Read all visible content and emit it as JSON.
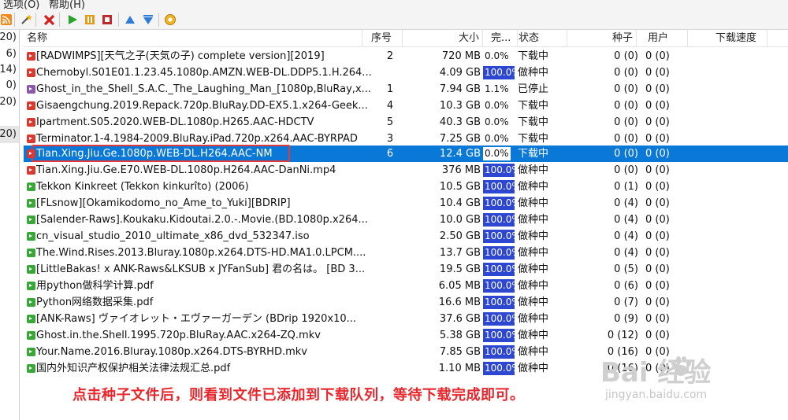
{
  "menubar": {
    "items": [
      "选项(O)",
      "帮助(H)"
    ]
  },
  "toolbar": {
    "icons": [
      "rss-icon",
      "wand-icon",
      "delete-icon",
      "play-icon",
      "pause-icon",
      "stop-icon",
      "move-up-icon",
      "move-down-icon",
      "settings-icon"
    ]
  },
  "left_panel": {
    "counts": [
      "20)",
      "6)",
      "14)",
      "0)",
      "20)",
      "20)"
    ]
  },
  "columns": {
    "name": "名称",
    "seq": "序号",
    "size": "大小",
    "done": "完...",
    "status": "状态",
    "seeds": "种子",
    "users": "用户",
    "speed": "下载速度"
  },
  "rows": [
    {
      "name": "[RADWIMPS][天气之子(天気の子) complete version][2019]",
      "seq": "2",
      "size": "720 MB",
      "done": "0.0%",
      "status": "下载中",
      "seeds": "0 (0)",
      "users": "0 (0)",
      "icon_color": "#d93a2f",
      "progress": 0.0
    },
    {
      "name": "Chernobyl.S01E01.1.23.45.1080p.AMZN.WEB-DL.DDP5.1.H.264...",
      "seq": "",
      "size": "4.09 GB",
      "done": "100.0%",
      "status": "做种中",
      "seeds": "0 (0)",
      "users": "0 (0)",
      "icon_color": "#d93a2f",
      "progress": 100.0
    },
    {
      "name": "Ghost_in_the_Shell_S.A.C._The_Laughing_Man_[1080p,BluRay,x...",
      "seq": "1",
      "size": "7.94 GB",
      "done": "1.1%",
      "status": "已停止",
      "seeds": "0 (0)",
      "users": "0 (0)",
      "icon_color": "#8a5aa8",
      "progress": 1.1
    },
    {
      "name": "Gisaengchung.2019.Repack.720p.BluRay.DD-EX5.1.x264-Geek...",
      "seq": "4",
      "size": "10.3 GB",
      "done": "0.0%",
      "status": "下载中",
      "seeds": "0 (0)",
      "users": "0 (0)",
      "icon_color": "#d93a2f",
      "progress": 0.0
    },
    {
      "name": "Ipartment.S05.2020.WEB-DL.1080p.H265.AAC-HDCTV",
      "seq": "5",
      "size": "40.3 GB",
      "done": "0.0%",
      "status": "下载中",
      "seeds": "0 (0)",
      "users": "0 (0)",
      "icon_color": "#d93a2f",
      "progress": 0.0
    },
    {
      "name": "Terminator.1-4.1984-2009.BluRay.iPad.720p.x264.AAC-BYRPAD",
      "seq": "3",
      "size": "7.25 GB",
      "done": "0.0%",
      "status": "下载中",
      "seeds": "0 (0)",
      "users": "0 (0)",
      "icon_color": "#d93a2f",
      "progress": 0.0
    },
    {
      "name": "Tian.Xing.Jiu.Ge.1080p.WEB-DL.H264.AAC-NM",
      "seq": "6",
      "size": "12.4 GB",
      "done": "0.0%",
      "status": "下载中",
      "seeds": "0 (0)",
      "users": "0 (0)",
      "icon_color": "#d93a2f",
      "progress": 0.0,
      "selected": true
    },
    {
      "name": "Tian.Xing.Jiu.Ge.E70.WEB-DL.1080p.H264.AAC-DanNi.mp4",
      "seq": "",
      "size": "376 MB",
      "done": "100.0%",
      "status": "做种中",
      "seeds": "0 (0)",
      "users": "0 (0)",
      "icon_color": "#d93a2f",
      "progress": 100.0
    },
    {
      "name": "Tekkon Kinkreet (Tekkon kinkurîto) (2006)",
      "seq": "",
      "size": "10.5 GB",
      "done": "100.0%",
      "status": "做种中",
      "seeds": "0 (1)",
      "users": "0 (0)",
      "icon_color": "#3aa63a",
      "progress": 100.0
    },
    {
      "name": "[FLsnow][Okamikodomo_no_Ame_to_Yuki][BDRIP]",
      "seq": "",
      "size": "10.4 GB",
      "done": "100.0%",
      "status": "做种中",
      "seeds": "0 (4)",
      "users": "0 (0)",
      "icon_color": "#3aa63a",
      "progress": 100.0
    },
    {
      "name": "[Salender-Raws].Koukaku.Kidoutai.2.0.-.Movie.(BD.1080p.x264...",
      "seq": "",
      "size": "10.0 GB",
      "done": "100.0%",
      "status": "做种中",
      "seeds": "0 (4)",
      "users": "0 (0)",
      "icon_color": "#3aa63a",
      "progress": 100.0
    },
    {
      "name": "cn_visual_studio_2010_ultimate_x86_dvd_532347.iso",
      "seq": "",
      "size": "2.50 GB",
      "done": "100.0%",
      "status": "做种中",
      "seeds": "0 (4)",
      "users": "0 (0)",
      "icon_color": "#3aa63a",
      "progress": 100.0
    },
    {
      "name": "The.Wind.Rises.2013.Bluray.1080p.x264.DTS-HD.MA1.0.LPCM....",
      "seq": "",
      "size": "13.7 GB",
      "done": "100.0%",
      "status": "做种中",
      "seeds": "0 (4)",
      "users": "0 (0)",
      "icon_color": "#3aa63a",
      "progress": 100.0
    },
    {
      "name": "[LittleBakas! x ANK-Raws&LKSUB x JYFanSub] 君の名は。 [BD 3...",
      "seq": "",
      "size": "19.5 GB",
      "done": "100.0%",
      "status": "做种中",
      "seeds": "0 (5)",
      "users": "0 (0)",
      "icon_color": "#3aa63a",
      "progress": 100.0
    },
    {
      "name": "用python做科学计算.pdf",
      "seq": "",
      "size": "6.05 MB",
      "done": "100.0%",
      "status": "做种中",
      "seeds": "0 (6)",
      "users": "0 (0)",
      "icon_color": "#3aa63a",
      "progress": 100.0
    },
    {
      "name": "Python网络数据采集.pdf",
      "seq": "",
      "size": "16.6 MB",
      "done": "100.0%",
      "status": "做种中",
      "seeds": "0 (7)",
      "users": "0 (0)",
      "icon_color": "#3aa63a",
      "progress": 100.0
    },
    {
      "name": "[ANK-Raws] ヴァイオレット・エヴァーガーデン (BDrip 1920x10...",
      "seq": "",
      "size": "37.6 GB",
      "done": "100.0%",
      "status": "做种中",
      "seeds": "0 (9)",
      "users": "0 (0)",
      "icon_color": "#3aa63a",
      "progress": 100.0
    },
    {
      "name": "Ghost.in.the.Shell.1995.720p.BluRay.AAC.x264-ZQ.mkv",
      "seq": "",
      "size": "5.38 GB",
      "done": "100.0%",
      "status": "做种中",
      "seeds": "0 (12)",
      "users": "0 (0)",
      "icon_color": "#3aa63a",
      "progress": 100.0
    },
    {
      "name": "Your.Name.2016.Bluray.1080p.x264.DTS-BYRHD.mkv",
      "seq": "",
      "size": "7.85 GB",
      "done": "100.0%",
      "status": "做种中",
      "seeds": "0 (16)",
      "users": "0 (0)",
      "icon_color": "#3aa63a",
      "progress": 100.0
    },
    {
      "name": "国内外知识产权保护相关法律法规汇总.pdf",
      "seq": "",
      "size": "1.10 MB",
      "done": "100.0%",
      "status": "做种中",
      "seeds": "0 (16)",
      "users": "0 (0)",
      "icon_color": "#3aa63a",
      "progress": 100.0
    }
  ],
  "caption": "点击种子文件后，则看到文件已添加到下载队列，等待下载完成即可。",
  "watermark": {
    "main": "Bai  经验",
    "sub": "jingyan.baidu.com"
  },
  "colors": {
    "selection": "#0a78d7",
    "progress_full": "#2d47d1",
    "highlight_box": "#e23a3a",
    "caption": "#e8262c"
  }
}
